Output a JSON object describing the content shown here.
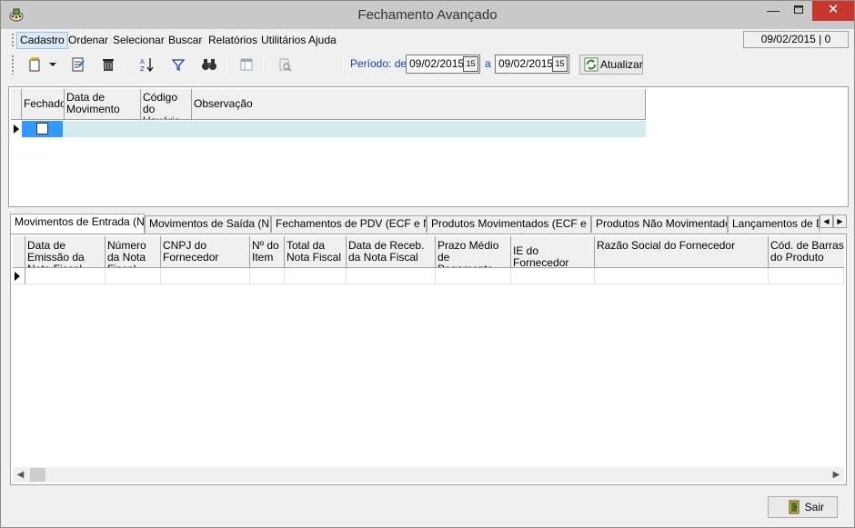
{
  "window": {
    "title": "Fechamento Avançado",
    "minimize_icon": "minimize-icon",
    "maximize_icon": "maximize-icon",
    "close_icon": "close-icon"
  },
  "menu": {
    "items": [
      "Cadastro",
      "Ordenar",
      "Selecionar",
      "Buscar",
      "Relatórios",
      "Utilitários",
      "Ajuda"
    ],
    "status_date": "09/02/2015 | 0"
  },
  "toolbar": {
    "period_label": "Período: de",
    "date_from": "09/02/2015",
    "to_label": "a",
    "date_to": "09/02/2015",
    "calendar_label": "15",
    "refresh_label": "Atualizar",
    "icons": [
      "new-record-icon",
      "dropdown-arrow-icon",
      "edit-document-icon",
      "trash-icon",
      "sort-az-icon",
      "filter-icon",
      "binoculars-icon",
      "columns-icon",
      "print-preview-icon",
      "refresh-icon"
    ]
  },
  "upper_grid": {
    "columns": [
      "Fechado",
      "Data de Movimento",
      "Código do Usuário",
      "Observação"
    ],
    "rows": [
      {
        "fechado": false,
        "data": "",
        "codigo": "",
        "observacao": ""
      }
    ]
  },
  "tabs": {
    "items": [
      "Movimentos de Entrada (NF)",
      "Movimentos de Saída (NF)",
      "Fechamentos de PDV (ECF e NF)",
      "Produtos Movimentados (ECF e NF)",
      "Produtos Não Movimentados",
      "Lançamentos de De"
    ],
    "active_index": 0
  },
  "lower_grid": {
    "columns": [
      "Data de Emissão da Nota Fiscal",
      "Número da Nota Fiscal",
      "CNPJ do Fornecedor",
      "Nº do Item",
      "Total da Nota Fiscal",
      "Data de Receb. da Nota Fiscal",
      "Prazo Médio de Pagamento",
      "IE do Fornecedor",
      "Razão Social do Fornecedor",
      "Cód. de Barras do Produto"
    ]
  },
  "footer": {
    "exit_label": "Sair"
  }
}
